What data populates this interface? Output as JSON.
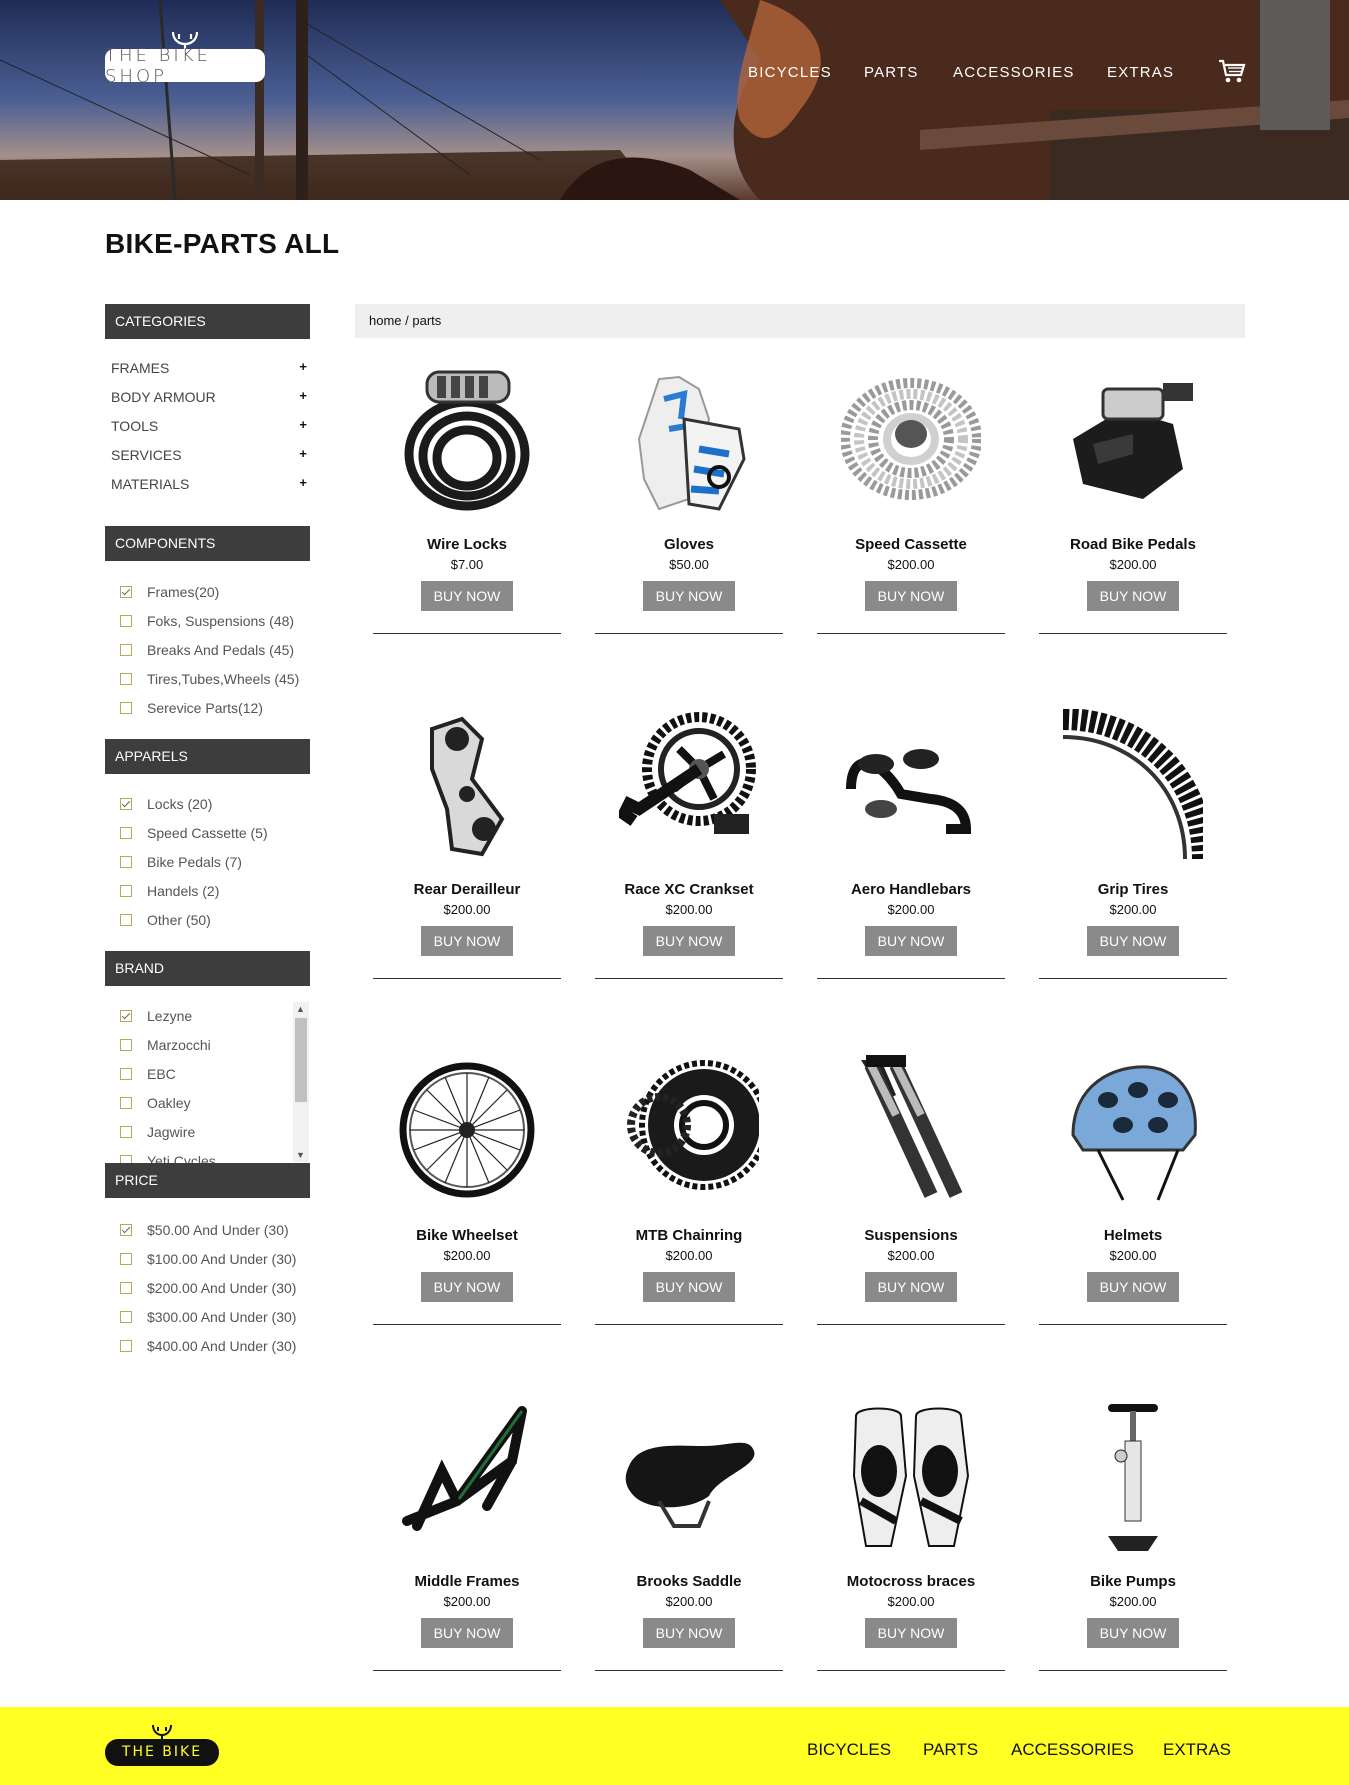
{
  "header": {
    "logo_text": "THE BIKE SHOP",
    "nav": [
      "BICYCLES",
      "PARTS",
      "ACCESSORIES",
      "EXTRAS"
    ],
    "cart_icon": "cart-icon"
  },
  "page_title": "BIKE-PARTS ALL",
  "breadcrumb": "home / parts",
  "sidebar": {
    "categories": {
      "title": "CATEGORIES",
      "items": [
        "FRAMES",
        "BODY ARMOUR",
        "TOOLS",
        "SERVICES",
        "MATERIALS"
      ],
      "expand_symbol": "+"
    },
    "components": {
      "title": "COMPONENTS",
      "items": [
        {
          "label": "Frames(20)",
          "checked": true
        },
        {
          "label": "Foks, Suspensions (48)",
          "checked": false
        },
        {
          "label": "Breaks And Pedals (45)",
          "checked": false
        },
        {
          "label": "Tires,Tubes,Wheels (45)",
          "checked": false
        },
        {
          "label": "Serevice Parts(12)",
          "checked": false
        }
      ]
    },
    "apparels": {
      "title": "APPARELS",
      "items": [
        {
          "label": "Locks (20)",
          "checked": true
        },
        {
          "label": "Speed Cassette (5)",
          "checked": false
        },
        {
          "label": "Bike Pedals (7)",
          "checked": false
        },
        {
          "label": "Handels (2)",
          "checked": false
        },
        {
          "label": "Other (50)",
          "checked": false
        }
      ]
    },
    "brand": {
      "title": "BRAND",
      "items": [
        {
          "label": "Lezyne",
          "checked": true
        },
        {
          "label": "Marzocchi",
          "checked": false
        },
        {
          "label": "EBC",
          "checked": false
        },
        {
          "label": "Oakley",
          "checked": false
        },
        {
          "label": "Jagwire",
          "checked": false
        },
        {
          "label": "Yeti Cycles",
          "checked": false
        }
      ]
    },
    "price": {
      "title": "PRICE",
      "items": [
        {
          "label": "$50.00 And Under (30)",
          "checked": true
        },
        {
          "label": "$100.00 And Under (30)",
          "checked": false
        },
        {
          "label": "$200.00 And Under (30)",
          "checked": false
        },
        {
          "label": "$300.00 And Under (30)",
          "checked": false
        },
        {
          "label": "$400.00 And Under (30)",
          "checked": false
        }
      ]
    }
  },
  "buy_label": "BUY NOW",
  "products": [
    {
      "name": "Wire Locks",
      "price": "$7.00",
      "icon": "lock"
    },
    {
      "name": "Gloves",
      "price": "$50.00",
      "icon": "gloves"
    },
    {
      "name": "Speed Cassette",
      "price": "$200.00",
      "icon": "cassette"
    },
    {
      "name": "Road Bike Pedals",
      "price": "$200.00",
      "icon": "pedal"
    },
    {
      "name": "Rear Derailleur",
      "price": "$200.00",
      "icon": "derailleur"
    },
    {
      "name": "Race XC Crankset",
      "price": "$200.00",
      "icon": "crankset"
    },
    {
      "name": "Aero Handlebars",
      "price": "$200.00",
      "icon": "handlebars"
    },
    {
      "name": "Grip Tires",
      "price": "$200.00",
      "icon": "tire"
    },
    {
      "name": "Bike Wheelset",
      "price": "$200.00",
      "icon": "wheel"
    },
    {
      "name": "MTB Chainring",
      "price": "$200.00",
      "icon": "chainring"
    },
    {
      "name": "Suspensions",
      "price": "$200.00",
      "icon": "fork"
    },
    {
      "name": "Helmets",
      "price": "$200.00",
      "icon": "helmet"
    },
    {
      "name": "Middle Frames",
      "price": "$200.00",
      "icon": "frame"
    },
    {
      "name": "Brooks Saddle",
      "price": "$200.00",
      "icon": "saddle"
    },
    {
      "name": "Motocross braces",
      "price": "$200.00",
      "icon": "braces"
    },
    {
      "name": "Bike Pumps",
      "price": "$200.00",
      "icon": "pump"
    }
  ],
  "footer": {
    "logo_text": "THE BIKE SHOP",
    "nav": [
      "BICYCLES",
      "PARTS",
      "ACCESSORIES",
      "EXTRAS"
    ]
  }
}
